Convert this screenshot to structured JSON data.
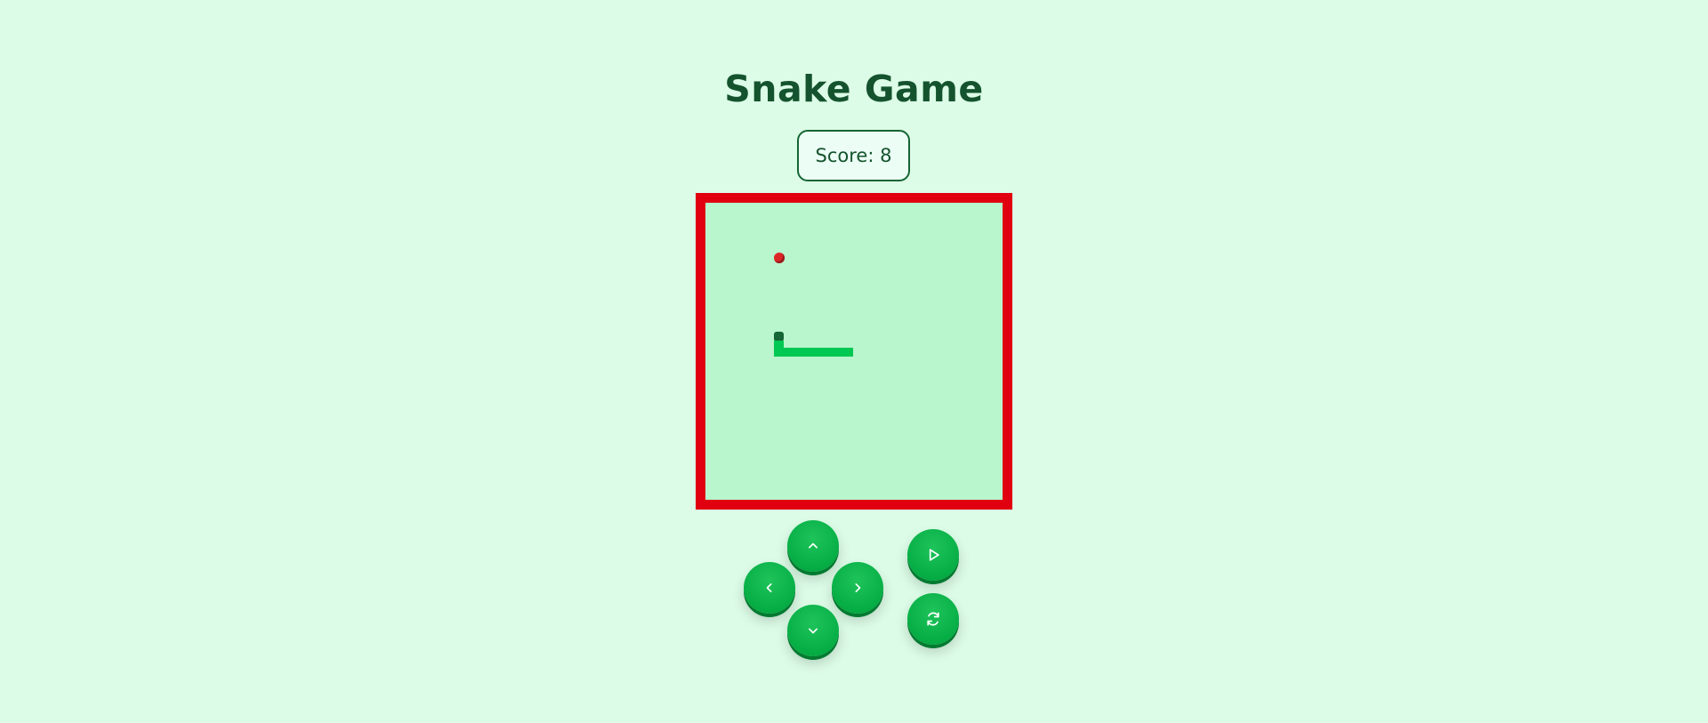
{
  "app": {
    "title": "Snake Game",
    "score_text": "Score: 8"
  },
  "colors": {
    "background": "#dcfce7",
    "title": "#14532d",
    "board_border": "#e00010",
    "board_fill": "#b9f5cd",
    "snake_head": "#166534",
    "snake_body": "#00c853",
    "food": "#dc2626",
    "button": "#06ad45"
  },
  "controls": {
    "up": "chevron-up-icon",
    "left": "chevron-left-icon",
    "right": "chevron-right-icon",
    "down": "chevron-down-icon",
    "play": "play-icon",
    "restart": "restart-icon"
  }
}
